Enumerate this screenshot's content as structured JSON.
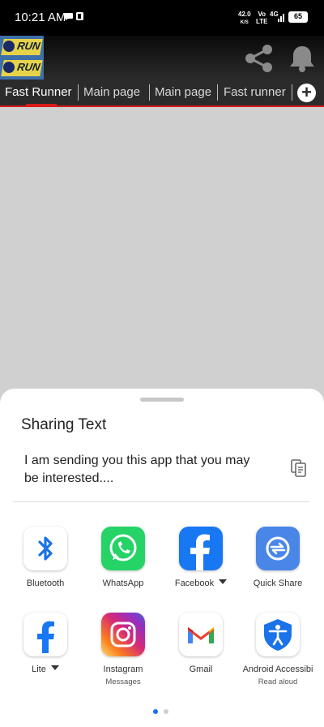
{
  "status_bar": {
    "time": "10:21 AM",
    "net_speed_value": "42.0",
    "net_speed_unit": "K/S",
    "volte_top": "Vo",
    "volte_bottom": "LTE",
    "network": "4G",
    "battery": "65"
  },
  "tabs": [
    {
      "label": "Fast Runner",
      "active": true
    },
    {
      "label": "Main page",
      "active": false
    },
    {
      "label": "Main page",
      "active": false
    },
    {
      "label": "Fast runner",
      "active": false
    }
  ],
  "share_sheet": {
    "title": "Sharing Text",
    "text": "I am sending you this app that you may be interested....",
    "apps": [
      {
        "label": "Bluetooth",
        "icon": "bluetooth-icon"
      },
      {
        "label": "WhatsApp",
        "icon": "whatsapp-icon"
      },
      {
        "label": "Facebook",
        "icon": "facebook-icon",
        "has_dropdown": true
      },
      {
        "label": "Quick Share",
        "icon": "quick-share-icon"
      },
      {
        "label": "Lite",
        "icon": "facebook-lite-icon",
        "has_dropdown": true
      },
      {
        "label": "Instagram",
        "sublabel": "Messages",
        "icon": "instagram-icon"
      },
      {
        "label": "Gmail",
        "icon": "gmail-icon"
      },
      {
        "label": "Android Accessibi",
        "sublabel": "Read aloud",
        "icon": "accessibility-icon"
      }
    ],
    "page_count": 2,
    "current_page": 1
  },
  "colors": {
    "accent_red": "#d81c1c",
    "tab_bar": "#2b2b2b",
    "dot_active": "#1a73e8",
    "dot_inactive": "#c8d0d8"
  }
}
